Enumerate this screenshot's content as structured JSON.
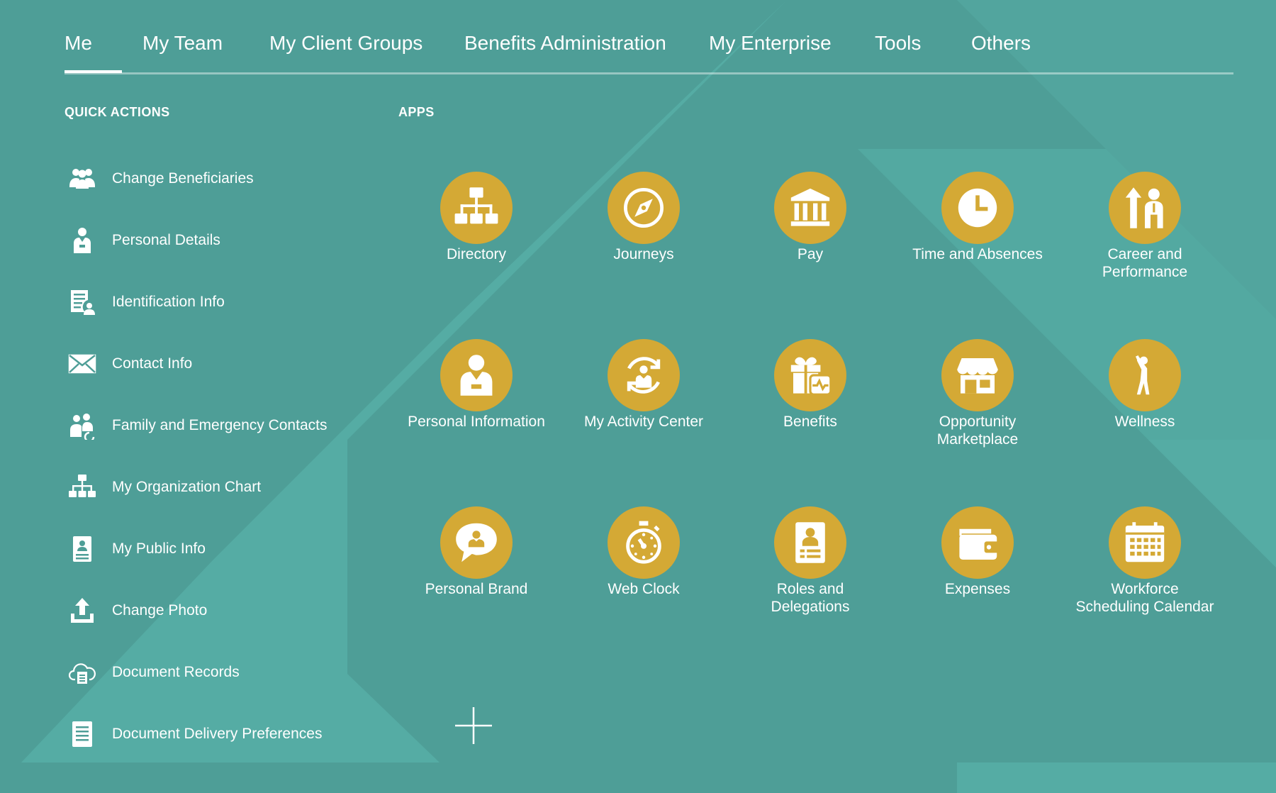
{
  "nav": {
    "tabs": [
      {
        "label": "Me"
      },
      {
        "label": "My Team"
      },
      {
        "label": "My Client Groups"
      },
      {
        "label": "Benefits Administration"
      },
      {
        "label": "My Enterprise"
      },
      {
        "label": "Tools"
      },
      {
        "label": "Others"
      }
    ],
    "active": "Me"
  },
  "quick_actions": {
    "title": "QUICK ACTIONS",
    "items": [
      {
        "label": "Change Beneficiaries",
        "icon": "people-group-icon"
      },
      {
        "label": "Personal Details",
        "icon": "person-badge-icon"
      },
      {
        "label": "Identification Info",
        "icon": "id-document-icon"
      },
      {
        "label": "Contact Info",
        "icon": "envelope-icon"
      },
      {
        "label": "Family and Emergency Contacts",
        "icon": "family-contacts-icon"
      },
      {
        "label": "My Organization Chart",
        "icon": "org-chart-icon"
      },
      {
        "label": "My Public Info",
        "icon": "public-info-icon"
      },
      {
        "label": "Change Photo",
        "icon": "upload-icon"
      },
      {
        "label": "Document Records",
        "icon": "cloud-document-icon"
      },
      {
        "label": "Document Delivery Preferences",
        "icon": "document-list-icon"
      }
    ]
  },
  "apps": {
    "title": "APPS",
    "items": [
      {
        "label": "Directory",
        "icon": "org-chart-icon"
      },
      {
        "label": "Journeys",
        "icon": "compass-icon"
      },
      {
        "label": "Pay",
        "icon": "bank-icon"
      },
      {
        "label": "Time and Absences",
        "icon": "clock-icon"
      },
      {
        "label": "Career and Performance",
        "icon": "career-growth-icon"
      },
      {
        "label": "Personal Information",
        "icon": "person-badge-icon"
      },
      {
        "label": "My Activity Center",
        "icon": "activity-cycle-icon"
      },
      {
        "label": "Benefits",
        "icon": "gift-health-icon"
      },
      {
        "label": "Opportunity Marketplace",
        "icon": "storefront-icon"
      },
      {
        "label": "Wellness",
        "icon": "stretching-person-icon"
      },
      {
        "label": "Personal Brand",
        "icon": "speech-bubble-person-icon"
      },
      {
        "label": "Web Clock",
        "icon": "stopwatch-icon"
      },
      {
        "label": "Roles and Delegations",
        "icon": "badge-card-icon"
      },
      {
        "label": "Expenses",
        "icon": "wallet-icon"
      },
      {
        "label": "Workforce Scheduling Calendar",
        "icon": "calendar-icon"
      }
    ],
    "add_icon": "plus-icon"
  },
  "colors": {
    "background": "#4e9e97",
    "background_light": "#55aca4",
    "app_circle": "#d4a935",
    "text": "#ffffff"
  }
}
